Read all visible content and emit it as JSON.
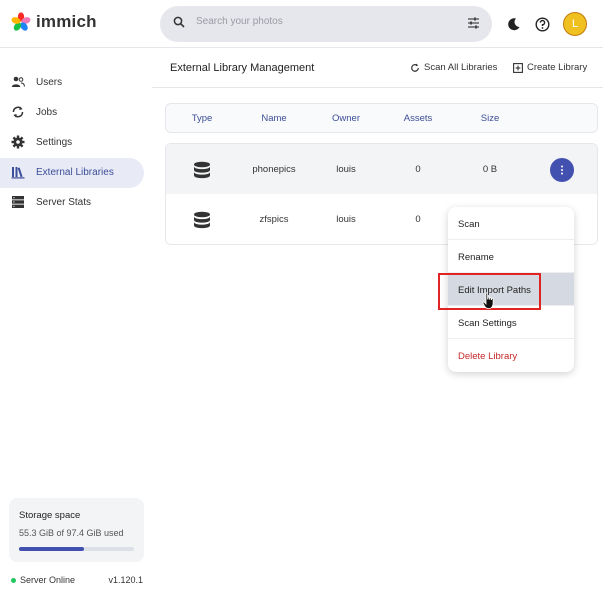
{
  "app": {
    "name": "immich"
  },
  "search": {
    "placeholder": "Search your photos"
  },
  "user": {
    "initial": "L"
  },
  "sidebar": {
    "items": [
      {
        "label": "Users",
        "icon": "users-icon"
      },
      {
        "label": "Jobs",
        "icon": "sync-icon"
      },
      {
        "label": "Settings",
        "icon": "gear-icon"
      },
      {
        "label": "External Libraries",
        "icon": "bookshelf-icon",
        "active": true
      },
      {
        "label": "Server Stats",
        "icon": "server-icon"
      }
    ],
    "storage": {
      "title": "Storage space",
      "used_text": "55.3 GiB of 97.4 GiB used",
      "used_fraction": 0.568
    },
    "server": {
      "status": "Server Online",
      "version": "v1.120.1"
    }
  },
  "page": {
    "title": "External Library Management",
    "actions": {
      "scan_all": "Scan All Libraries",
      "create": "Create Library"
    }
  },
  "table": {
    "headers": [
      "Type",
      "Name",
      "Owner",
      "Assets",
      "Size"
    ],
    "rows": [
      {
        "name": "phonepics",
        "owner": "louis",
        "assets": "0",
        "size": "0 B"
      },
      {
        "name": "zfspics",
        "owner": "louis",
        "assets": "0",
        "size": ""
      }
    ]
  },
  "menu": {
    "items": [
      "Scan",
      "Rename",
      "Edit Import Paths",
      "Scan Settings",
      "Delete Library"
    ],
    "hovered_index": 2
  },
  "colors": {
    "accent": "#4250af",
    "danger": "#c62828",
    "online": "#22c55e",
    "annotation": "#e02424"
  }
}
